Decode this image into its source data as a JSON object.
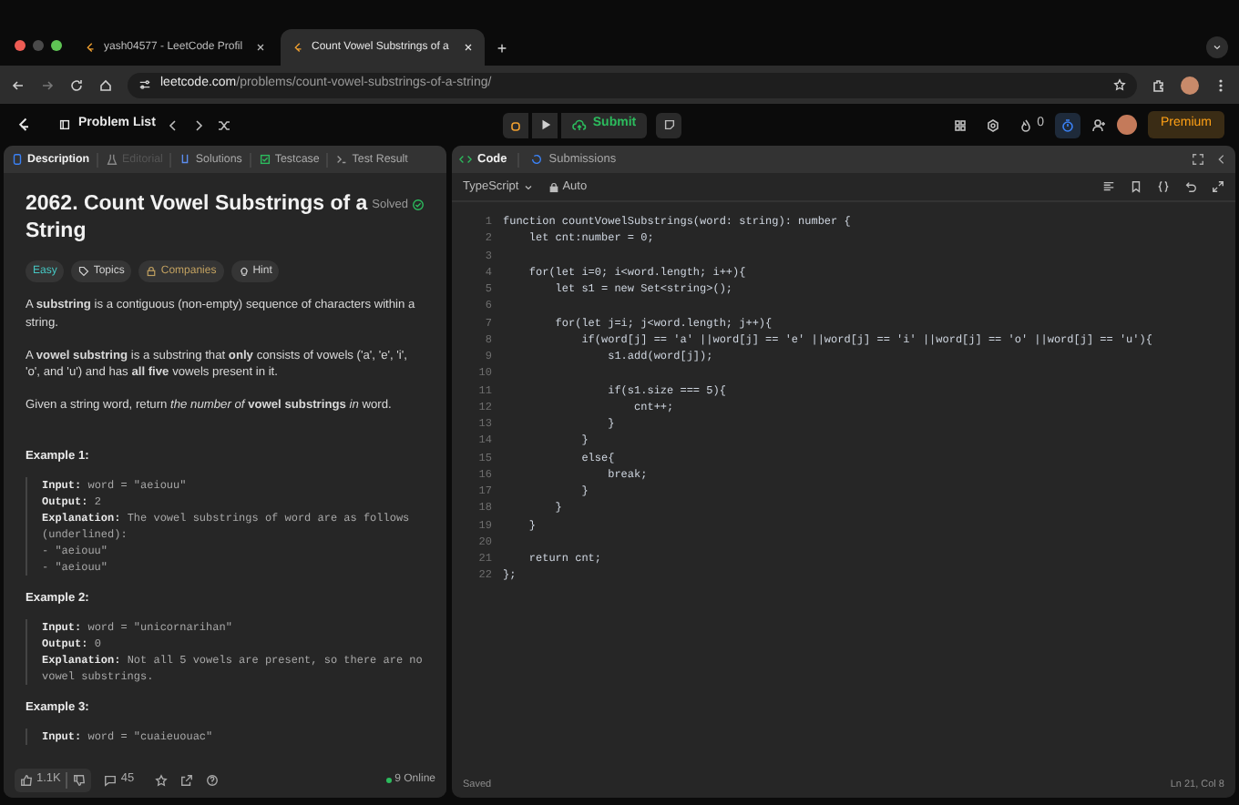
{
  "browser": {
    "tabs": [
      {
        "title": "yash04577 - LeetCode Profil",
        "selected": false
      },
      {
        "title": "Count Vowel Substrings of a",
        "selected": true
      }
    ],
    "url": {
      "host": "leetcode.com",
      "path": "/problems/count-vowel-substrings-of-a-string/"
    }
  },
  "nav": {
    "problem_list": "Problem List",
    "submit": "Submit",
    "streak": "0",
    "premium": "Premium"
  },
  "left_tabs": [
    {
      "label": "Description",
      "selected": true,
      "disabled": false
    },
    {
      "label": "Editorial",
      "selected": false,
      "disabled": true
    },
    {
      "label": "Solutions",
      "selected": false,
      "disabled": false
    },
    {
      "label": "Testcase",
      "selected": false,
      "disabled": false
    },
    {
      "label": "Test Result",
      "selected": false,
      "disabled": false
    }
  ],
  "problem": {
    "title": "2062. Count Vowel Substrings of a String",
    "status": "Solved",
    "tags": [
      {
        "label": "Easy",
        "kind": "difficulty"
      },
      {
        "label": "Topics",
        "kind": "topics"
      },
      {
        "label": "Companies",
        "kind": "companies"
      },
      {
        "label": "Hint",
        "kind": "hint"
      }
    ],
    "paragraphs": [
      "A **substring** is a contiguous (non-empty) sequence of characters within a string.",
      "A **vowel substring** is a substring that **only** consists of vowels ('a', 'e', 'i', 'o', and 'u') and has **all five** vowels present in it.",
      "Given a string word, return *the number of* **vowel substrings** *in* word."
    ],
    "examples": [
      {
        "title": "Example 1:",
        "lines": [
          {
            "label": "Input:",
            "value": "word = \"aeiouu\""
          },
          {
            "label": "Output:",
            "value": "2"
          },
          {
            "label": "Explanation:",
            "value": "The vowel substrings of word are as follows (underlined):\n- \"aeiouu\"\n- \"aeiouu\""
          }
        ]
      },
      {
        "title": "Example 2:",
        "lines": [
          {
            "label": "Input:",
            "value": "word = \"unicornarihan\""
          },
          {
            "label": "Output:",
            "value": "0"
          },
          {
            "label": "Explanation:",
            "value": "Not all 5 vowels are present, so there are no vowel substrings."
          }
        ]
      },
      {
        "title": "Example 3:",
        "lines": [
          {
            "label": "Input:",
            "value": "word = \"cuaieuouac\""
          }
        ]
      }
    ]
  },
  "left_footer": {
    "likes": "1.1K",
    "comments": "45",
    "online": "9 Online"
  },
  "right_tabs": [
    {
      "label": "Code",
      "selected": true
    },
    {
      "label": "Submissions",
      "selected": false
    }
  ],
  "editor": {
    "language": "TypeScript",
    "mode": "Auto",
    "lines": [
      {
        "n": "1",
        "text": "function countVowelSubstrings(word: string): number {"
      },
      {
        "n": "2",
        "text": "    let cnt:number = 0;"
      },
      {
        "n": "3"
      },
      {
        "n": "4",
        "text": "    for(let i=0; i<word.length; i++){"
      },
      {
        "n": "5",
        "text": "        let s1 = new Set<string>();"
      },
      {
        "n": "6"
      },
      {
        "n": "7",
        "text": "        for(let j=i; j<word.length; j++){"
      },
      {
        "n": "8",
        "text": "            if(word[j] == 'a' ||word[j] == 'e' ||word[j] == 'i' ||word[j] == 'o' ||word[j] == 'u'){"
      },
      {
        "n": "9",
        "text": "                s1.add(word[j]);"
      },
      {
        "n": "10"
      },
      {
        "n": "11",
        "text": "                if(s1.size === 5){"
      },
      {
        "n": "12",
        "text": "                    cnt++;"
      },
      {
        "n": "13",
        "text": "                }"
      },
      {
        "n": "14",
        "text": "            }"
      },
      {
        "n": "15",
        "text": "            else{"
      },
      {
        "n": "16",
        "text": "                break;"
      },
      {
        "n": "17",
        "text": "            }"
      },
      {
        "n": "18",
        "text": "        }"
      },
      {
        "n": "19",
        "text": "    }"
      },
      {
        "n": "20"
      },
      {
        "n": "21",
        "text": "    return cnt;"
      },
      {
        "n": "22",
        "text": "};"
      }
    ],
    "status": "Saved",
    "cursor": "Ln 21, Col 8"
  }
}
